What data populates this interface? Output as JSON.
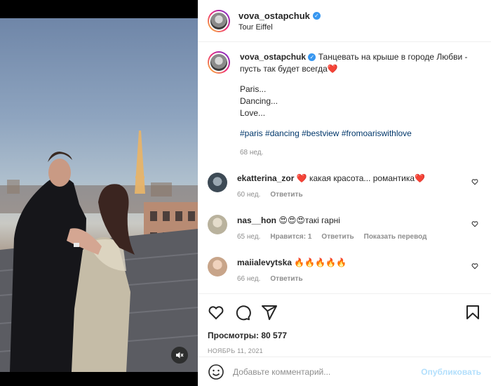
{
  "post": {
    "username": "vova_ostapchuk",
    "location": "Tour Eiffel",
    "caption_text": "Танцевать на крыше в городе Любви - пусть так будет всегда",
    "caption_heart": "❤️",
    "caption_lines": [
      "Paris...",
      "Dancing...",
      "Love..."
    ],
    "hashtags": [
      "#paris",
      "#dancing",
      "#bestview",
      "#fromoariswithlove"
    ],
    "caption_age": "68 нед."
  },
  "comments": [
    {
      "username": "ekatterina_zor",
      "text": "❤️ какая красота... романтика❤️",
      "age": "60 нед.",
      "reply_label": "Ответить",
      "likes_label": "",
      "translate_label": "",
      "avatar_color": "#3d4a55"
    },
    {
      "username": "nas__hon",
      "text": "😍😍😍такі гарні",
      "age": "65 нед.",
      "likes_label": "Нравится: 1",
      "reply_label": "Ответить",
      "translate_label": "Показать перевод",
      "avatar_color": "#b9b29d"
    },
    {
      "username": "maiialevytska",
      "text": "🔥🔥🔥🔥🔥",
      "age": "66 нед.",
      "reply_label": "Ответить",
      "likes_label": "",
      "translate_label": "",
      "avatar_color": "#c8a58a"
    }
  ],
  "actions": {
    "views": "Просмотры: 80 577",
    "date": "НОЯБРЬ 11, 2021"
  },
  "add_comment": {
    "placeholder": "Добавьте комментарий...",
    "publish_label": "Опубликовать"
  },
  "colors": {
    "link": "#00376b",
    "verified": "#3897f0",
    "publish_disabled": "#b2dffc",
    "meta_gray": "#8e8e8e"
  },
  "icons": [
    "mute-icon",
    "verified-icon",
    "heart-icon",
    "comment-icon",
    "share-icon",
    "bookmark-icon",
    "emoji-icon"
  ]
}
